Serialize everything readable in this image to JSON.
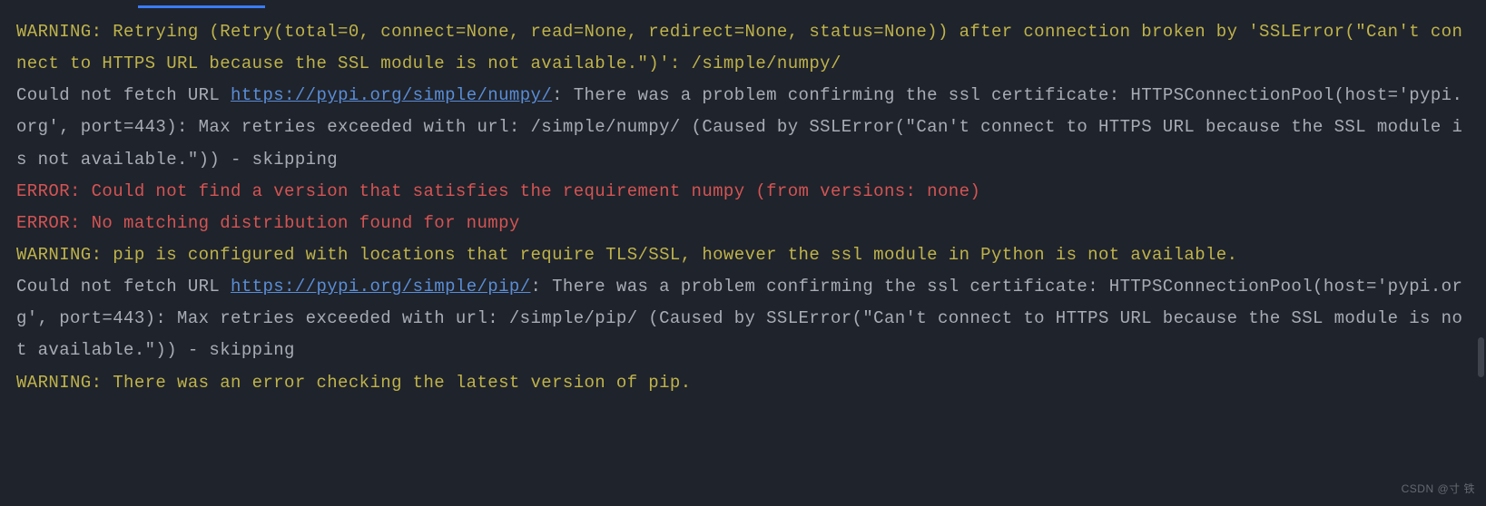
{
  "tabIndicator": true,
  "lines": [
    {
      "segments": [
        {
          "cls": "warn",
          "text": "WARNING: Retrying (Retry(total=0, connect=None, read=None, redirect=None, status=None)) after connection broken by 'SSLError(\"Can't connect to HTTPS URL because the SSL module is not available.\")': /simple/numpy/"
        }
      ]
    },
    {
      "segments": [
        {
          "cls": "norm",
          "text": "Could not fetch URL "
        },
        {
          "cls": "link",
          "text": "https://pypi.org/simple/numpy/"
        },
        {
          "cls": "norm",
          "text": ": There was a problem confirming the ssl certificate: HTTPSConnectionPool(host='pypi.org', port=443): Max retries exceeded with url: /simple/numpy/ (Caused by SSLError(\"Can't connect to HTTPS URL because the SSL module is not available.\")) - skipping"
        }
      ]
    },
    {
      "segments": [
        {
          "cls": "err",
          "text": "ERROR: Could not find a version that satisfies the requirement numpy (from versions: none)"
        }
      ]
    },
    {
      "segments": [
        {
          "cls": "err",
          "text": "ERROR: No matching distribution found for numpy"
        }
      ]
    },
    {
      "segments": [
        {
          "cls": "warn",
          "text": "WARNING: pip is configured with locations that require TLS/SSL, however the ssl module in Python is not available."
        }
      ]
    },
    {
      "segments": [
        {
          "cls": "norm",
          "text": "Could not fetch URL "
        },
        {
          "cls": "link",
          "text": "https://pypi.org/simple/pip/"
        },
        {
          "cls": "norm",
          "text": ": There was a problem confirming the ssl certificate: HTTPSConnectionPool(host='pypi.org', port=443): Max retries exceeded with url: /simple/pip/ (Caused by SSLError(\"Can't connect to HTTPS URL because the SSL module is not available.\")) - skipping"
        }
      ]
    },
    {
      "segments": [
        {
          "cls": "warn",
          "text": "WARNING: There was an error checking the latest version of pip."
        }
      ]
    }
  ],
  "watermark": "CSDN @寸 铁"
}
